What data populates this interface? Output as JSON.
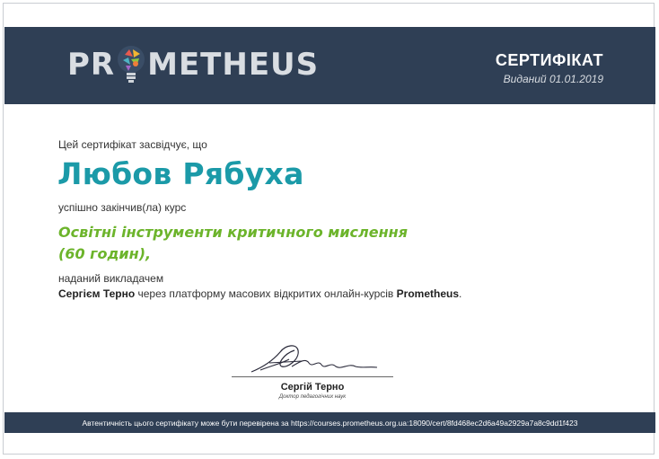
{
  "header": {
    "logo_text_left": "PR",
    "logo_text_right": "METHEUS",
    "title": "СЕРТИФІКАТ",
    "issued": "Виданий 01.01.2019"
  },
  "body": {
    "intro": "Цей сертифікат засвідчує, що",
    "recipient_name": "Любов Рябуха",
    "completed_text": "успішно закінчив(ла) курс",
    "course_title_line1": "Освітні інструменти критичного мислення",
    "course_title_line2": "(60 годин),",
    "given_by": "наданий викладачем",
    "instructor": "Сергієм Терно",
    "platform_mid": " через платформу масових відкритих онлайн-курсів ",
    "platform_name": "Prometheus",
    "platform_end": "."
  },
  "signature": {
    "name": "Сергій Терно",
    "role": "Доктор педагогічних наук"
  },
  "footer": {
    "verification": "Автентичність цього сертифікату може бути перевірена за https://courses.prometheus.org.ua:18090/cert/8fd468ec2d6a49a2929a7a8c9dd1f423"
  },
  "colors": {
    "header_bg": "#2f3f55",
    "name_color": "#1b9aa8",
    "course_color": "#6cb42b"
  }
}
